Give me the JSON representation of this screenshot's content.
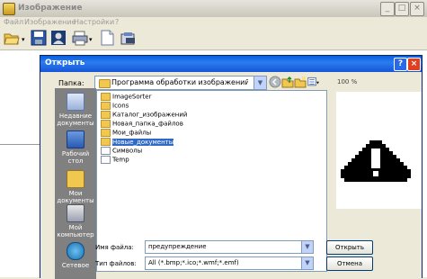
{
  "main_window": {
    "title": "Изображение",
    "menu": [
      "Файл",
      "Изображение",
      "Настройки",
      "?"
    ],
    "controls": {
      "minimize": "_",
      "maximize": "□",
      "close": "×"
    }
  },
  "toolbar": {
    "icons": [
      "open-folder-icon",
      "save-icon",
      "photo-icon",
      "print-icon",
      "document-icon",
      "scan-icon"
    ]
  },
  "dialog": {
    "title": "Открыть",
    "help_label": "?",
    "close_label": "×",
    "lookin_label": "Папка:",
    "lookin_value": "Программа обработки изображений",
    "places": [
      "Недавние документы",
      "Рабочий стол",
      "Мои документы",
      "Мой компьютер",
      "Сетевое"
    ],
    "files": [
      {
        "name": "ImageSorter",
        "selected": false
      },
      {
        "name": "Icons",
        "selected": false
      },
      {
        "name": "Каталог_изображений",
        "selected": false
      },
      {
        "name": "Новая_папка_файлов",
        "selected": false
      },
      {
        "name": "Мои_файлы",
        "selected": false
      },
      {
        "name": "Новые_документы",
        "selected": true
      },
      {
        "name": "Символы",
        "selected": false
      },
      {
        "name": "Temp",
        "selected": false
      }
    ],
    "filename_label": "Имя файла:",
    "filename_value": "предупреждение",
    "filetype_label": "Тип файлов:",
    "filetype_value": "All (*.bmp;*.ico;*.wmf;*.emf)",
    "open_button": "Открыть",
    "cancel_button": "Отмена",
    "preview_label": "100 %"
  }
}
